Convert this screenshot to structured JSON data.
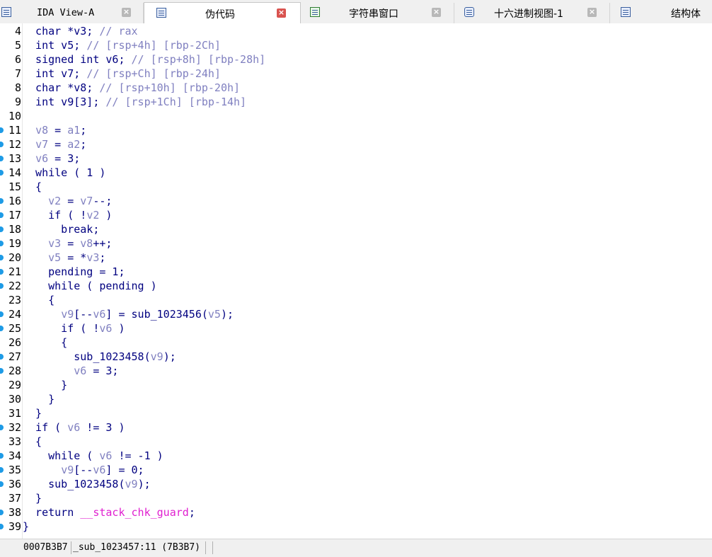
{
  "tabs": [
    {
      "label": "IDA View-A",
      "icon": "ida-view-icon",
      "active": false
    },
    {
      "label": "伪代码",
      "icon": "pseudocode-icon",
      "active": true
    },
    {
      "label": "字符串窗口",
      "icon": "strings-icon",
      "active": false
    },
    {
      "label": "十六进制视图-1",
      "icon": "hex-view-icon",
      "active": false
    },
    {
      "label": "结构体",
      "icon": "structures-icon",
      "active": false
    }
  ],
  "code_lines": [
    {
      "n": "4",
      "bp": false,
      "tokens": [
        [
          "pl",
          "  char *v3; "
        ],
        [
          "cm",
          "// rax"
        ]
      ]
    },
    {
      "n": "5",
      "bp": false,
      "tokens": [
        [
          "pl",
          "  int v5; "
        ],
        [
          "cm",
          "// [rsp+4h] [rbp-2Ch]"
        ]
      ]
    },
    {
      "n": "6",
      "bp": false,
      "tokens": [
        [
          "pl",
          "  signed int v6; "
        ],
        [
          "cm",
          "// [rsp+8h] [rbp-28h]"
        ]
      ]
    },
    {
      "n": "7",
      "bp": false,
      "tokens": [
        [
          "pl",
          "  int v7; "
        ],
        [
          "cm",
          "// [rsp+Ch] [rbp-24h]"
        ]
      ]
    },
    {
      "n": "8",
      "bp": false,
      "tokens": [
        [
          "pl",
          "  char *v8; "
        ],
        [
          "cm",
          "// [rsp+10h] [rbp-20h]"
        ]
      ]
    },
    {
      "n": "9",
      "bp": false,
      "tokens": [
        [
          "pl",
          "  int v9[3]; "
        ],
        [
          "cm",
          "// [rsp+1Ch] [rbp-14h]"
        ]
      ]
    },
    {
      "n": "10",
      "bp": false,
      "tokens": []
    },
    {
      "n": "11",
      "bp": true,
      "tokens": [
        [
          "pl",
          "  "
        ],
        [
          "var",
          "v8"
        ],
        [
          "pl",
          " = "
        ],
        [
          "var",
          "a1"
        ],
        [
          "pl",
          ";"
        ]
      ]
    },
    {
      "n": "12",
      "bp": true,
      "tokens": [
        [
          "pl",
          "  "
        ],
        [
          "var",
          "v7"
        ],
        [
          "pl",
          " = "
        ],
        [
          "var",
          "a2"
        ],
        [
          "pl",
          ";"
        ]
      ]
    },
    {
      "n": "13",
      "bp": true,
      "tokens": [
        [
          "pl",
          "  "
        ],
        [
          "var",
          "v6"
        ],
        [
          "pl",
          " = 3;"
        ]
      ]
    },
    {
      "n": "14",
      "bp": true,
      "tokens": [
        [
          "pl",
          "  while ( 1 )"
        ]
      ]
    },
    {
      "n": "15",
      "bp": false,
      "tokens": [
        [
          "pl",
          "  {"
        ]
      ]
    },
    {
      "n": "16",
      "bp": true,
      "tokens": [
        [
          "pl",
          "    "
        ],
        [
          "var",
          "v2"
        ],
        [
          "pl",
          " = "
        ],
        [
          "var",
          "v7"
        ],
        [
          "pl",
          "--;"
        ]
      ]
    },
    {
      "n": "17",
      "bp": true,
      "tokens": [
        [
          "pl",
          "    if ( !"
        ],
        [
          "var",
          "v2"
        ],
        [
          "pl",
          " )"
        ]
      ]
    },
    {
      "n": "18",
      "bp": true,
      "tokens": [
        [
          "pl",
          "      break;"
        ]
      ]
    },
    {
      "n": "19",
      "bp": true,
      "tokens": [
        [
          "pl",
          "    "
        ],
        [
          "var",
          "v3"
        ],
        [
          "pl",
          " = "
        ],
        [
          "var",
          "v8"
        ],
        [
          "pl",
          "++;"
        ]
      ]
    },
    {
      "n": "20",
      "bp": true,
      "tokens": [
        [
          "pl",
          "    "
        ],
        [
          "var",
          "v5"
        ],
        [
          "pl",
          " = *"
        ],
        [
          "var",
          "v3"
        ],
        [
          "pl",
          ";"
        ]
      ]
    },
    {
      "n": "21",
      "bp": true,
      "tokens": [
        [
          "pl",
          "    pending = 1;"
        ]
      ]
    },
    {
      "n": "22",
      "bp": true,
      "tokens": [
        [
          "pl",
          "    while ( pending )"
        ]
      ]
    },
    {
      "n": "23",
      "bp": false,
      "tokens": [
        [
          "pl",
          "    {"
        ]
      ]
    },
    {
      "n": "24",
      "bp": true,
      "tokens": [
        [
          "pl",
          "      "
        ],
        [
          "var",
          "v9"
        ],
        [
          "pl",
          "[--"
        ],
        [
          "var",
          "v6"
        ],
        [
          "pl",
          "] = sub_1023456("
        ],
        [
          "var",
          "v5"
        ],
        [
          "pl",
          ");"
        ]
      ]
    },
    {
      "n": "25",
      "bp": true,
      "tokens": [
        [
          "pl",
          "      if ( !"
        ],
        [
          "var",
          "v6"
        ],
        [
          "pl",
          " )"
        ]
      ]
    },
    {
      "n": "26",
      "bp": false,
      "tokens": [
        [
          "pl",
          "      {"
        ]
      ]
    },
    {
      "n": "27",
      "bp": true,
      "tokens": [
        [
          "pl",
          "        sub_1023458("
        ],
        [
          "var",
          "v9"
        ],
        [
          "pl",
          ");"
        ]
      ]
    },
    {
      "n": "28",
      "bp": true,
      "tokens": [
        [
          "pl",
          "        "
        ],
        [
          "var",
          "v6"
        ],
        [
          "pl",
          " = 3;"
        ]
      ]
    },
    {
      "n": "29",
      "bp": false,
      "tokens": [
        [
          "pl",
          "      }"
        ]
      ]
    },
    {
      "n": "30",
      "bp": false,
      "tokens": [
        [
          "pl",
          "    }"
        ]
      ]
    },
    {
      "n": "31",
      "bp": false,
      "tokens": [
        [
          "pl",
          "  }"
        ]
      ]
    },
    {
      "n": "32",
      "bp": true,
      "tokens": [
        [
          "pl",
          "  if ( "
        ],
        [
          "var",
          "v6"
        ],
        [
          "pl",
          " != 3 )"
        ]
      ]
    },
    {
      "n": "33",
      "bp": false,
      "tokens": [
        [
          "pl",
          "  {"
        ]
      ]
    },
    {
      "n": "34",
      "bp": true,
      "tokens": [
        [
          "pl",
          "    while ( "
        ],
        [
          "var",
          "v6"
        ],
        [
          "pl",
          " != -1 )"
        ]
      ]
    },
    {
      "n": "35",
      "bp": true,
      "tokens": [
        [
          "pl",
          "      "
        ],
        [
          "var",
          "v9"
        ],
        [
          "pl",
          "[--"
        ],
        [
          "var",
          "v6"
        ],
        [
          "pl",
          "] = 0;"
        ]
      ]
    },
    {
      "n": "36",
      "bp": true,
      "tokens": [
        [
          "pl",
          "    sub_1023458("
        ],
        [
          "var",
          "v9"
        ],
        [
          "pl",
          ");"
        ]
      ]
    },
    {
      "n": "37",
      "bp": false,
      "tokens": [
        [
          "pl",
          "  }"
        ]
      ]
    },
    {
      "n": "38",
      "bp": true,
      "tokens": [
        [
          "pl",
          "  return "
        ],
        [
          "imp",
          "__stack_chk_guard"
        ],
        [
          "pl",
          ";"
        ]
      ]
    },
    {
      "n": "39",
      "bp": true,
      "tokens": [
        [
          "pl",
          "}"
        ]
      ]
    }
  ],
  "status": {
    "address": "0007B3B7",
    "location": "_sub_1023457:11 (7B3B7)"
  },
  "colors": {
    "keyword": "#000080",
    "variable": "#8080c0",
    "comment": "#8080c0",
    "import": "#e020d0",
    "breakpoint_dot": "#1e9be6",
    "close_active": "#d9534f"
  }
}
